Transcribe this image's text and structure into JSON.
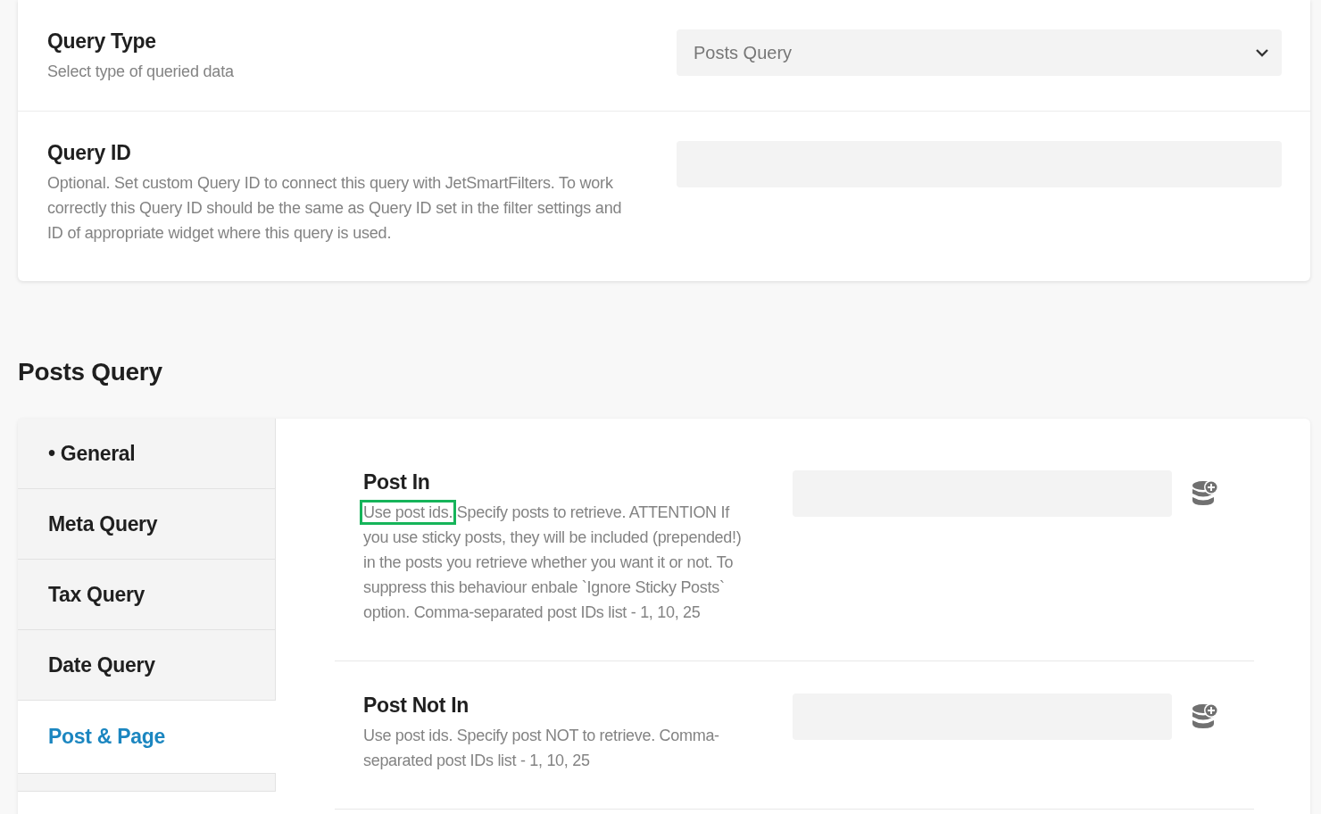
{
  "settings_card": {
    "rows": [
      {
        "kind": "select",
        "label": "Query Type",
        "description": "Select type of queried data",
        "value": "Posts Query"
      },
      {
        "kind": "text",
        "label": "Query ID",
        "description": "Optional. Set custom Query ID to connect this query with JetSmartFilters. To work correctly this Query ID should be the same as Query ID set in the filter settings and ID of appropriate widget where this query is used.",
        "value": ""
      }
    ]
  },
  "section_title": "Posts Query",
  "tabs": [
    {
      "label": "General",
      "bullet": "•",
      "selected": false
    },
    {
      "label": "Meta Query",
      "selected": false
    },
    {
      "label": "Tax Query",
      "selected": false
    },
    {
      "label": "Date Query",
      "selected": false
    },
    {
      "label": "Post & Page",
      "selected": true
    }
  ],
  "fields": [
    {
      "label": "Post In",
      "description": [
        {
          "text": "Use post ids.",
          "highlighted": true
        },
        {
          "text": " Specify posts to retrieve. ATTENTION If you use sticky posts, they will be included (prepended!) in the posts you retrieve whether you want it or not. To suppress this behaviour enbale `Ignore Sticky Posts` option. Comma-separated post IDs list - 1, 10, 25",
          "highlighted": false
        }
      ]
    },
    {
      "label": "Post Not In",
      "description": [
        {
          "text": "Use post ids. Specify post NOT to retrieve. Comma-separated post IDs list - 1, 10, 25",
          "highlighted": false
        }
      ]
    }
  ]
}
